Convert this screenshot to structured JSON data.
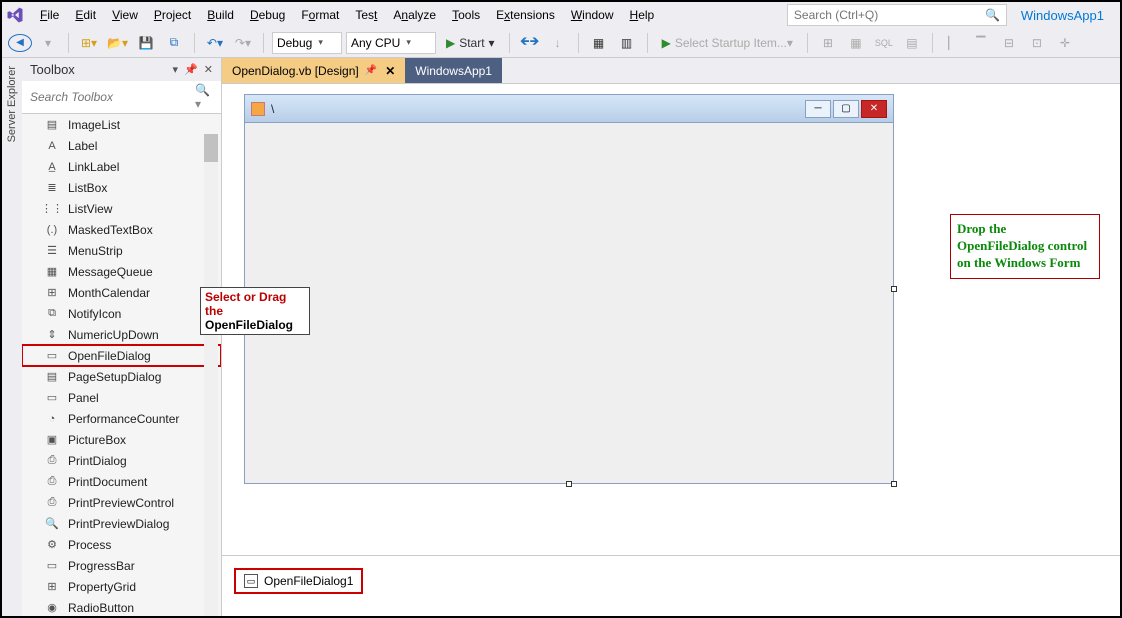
{
  "solution_name": "WindowsApp1",
  "search_placeholder": "Search (Ctrl+Q)",
  "menu": [
    {
      "label": "File",
      "uidx": 0
    },
    {
      "label": "Edit",
      "uidx": 0
    },
    {
      "label": "View",
      "uidx": 0
    },
    {
      "label": "Project",
      "uidx": 0
    },
    {
      "label": "Build",
      "uidx": 0
    },
    {
      "label": "Debug",
      "uidx": 0
    },
    {
      "label": "Format",
      "uidx": 1
    },
    {
      "label": "Test",
      "uidx": 3
    },
    {
      "label": "Analyze",
      "uidx": 1
    },
    {
      "label": "Tools",
      "uidx": 0
    },
    {
      "label": "Extensions",
      "uidx": 1
    },
    {
      "label": "Window",
      "uidx": 0
    },
    {
      "label": "Help",
      "uidx": 0
    }
  ],
  "toolbar": {
    "config": "Debug",
    "platform": "Any CPU",
    "start_label": "Start",
    "startup_label": "Select Startup Item..."
  },
  "sidebar": {
    "server_explorer": "Server Explorer"
  },
  "toolbox": {
    "title": "Toolbox",
    "search_placeholder": "Search Toolbox",
    "items": [
      {
        "label": "ImageList",
        "icon": "▤"
      },
      {
        "label": "Label",
        "icon": "A"
      },
      {
        "label": "LinkLabel",
        "icon": "A̲"
      },
      {
        "label": "ListBox",
        "icon": "≣"
      },
      {
        "label": "ListView",
        "icon": "⋮⋮"
      },
      {
        "label": "MaskedTextBox",
        "icon": "(.)"
      },
      {
        "label": "MenuStrip",
        "icon": "☰"
      },
      {
        "label": "MessageQueue",
        "icon": "▦"
      },
      {
        "label": "MonthCalendar",
        "icon": "⊞"
      },
      {
        "label": "NotifyIcon",
        "icon": "⧉"
      },
      {
        "label": "NumericUpDown",
        "icon": "⇕"
      },
      {
        "label": "OpenFileDialog",
        "icon": "▭",
        "highlight": true
      },
      {
        "label": "PageSetupDialog",
        "icon": "▤"
      },
      {
        "label": "Panel",
        "icon": "▭"
      },
      {
        "label": "PerformanceCounter",
        "icon": "◔"
      },
      {
        "label": "PictureBox",
        "icon": "▣"
      },
      {
        "label": "PrintDialog",
        "icon": "⎙"
      },
      {
        "label": "PrintDocument",
        "icon": "⎙"
      },
      {
        "label": "PrintPreviewControl",
        "icon": "⎙"
      },
      {
        "label": "PrintPreviewDialog",
        "icon": "🔍"
      },
      {
        "label": "Process",
        "icon": "⚙"
      },
      {
        "label": "ProgressBar",
        "icon": "▭"
      },
      {
        "label": "PropertyGrid",
        "icon": "⊞"
      },
      {
        "label": "RadioButton",
        "icon": "◉"
      }
    ]
  },
  "tabs": {
    "active": {
      "label": "OpenDialog.vb [Design]"
    },
    "inactive": {
      "label": "WindowsApp1"
    }
  },
  "form": {
    "title": "\\"
  },
  "tray": {
    "item": "OpenFileDialog1"
  },
  "annotations": {
    "green": "Drop the OpenFileDialog control on the Windows Form",
    "select_red": "Select or Drag the",
    "select_black": "OpenFileDialog"
  }
}
